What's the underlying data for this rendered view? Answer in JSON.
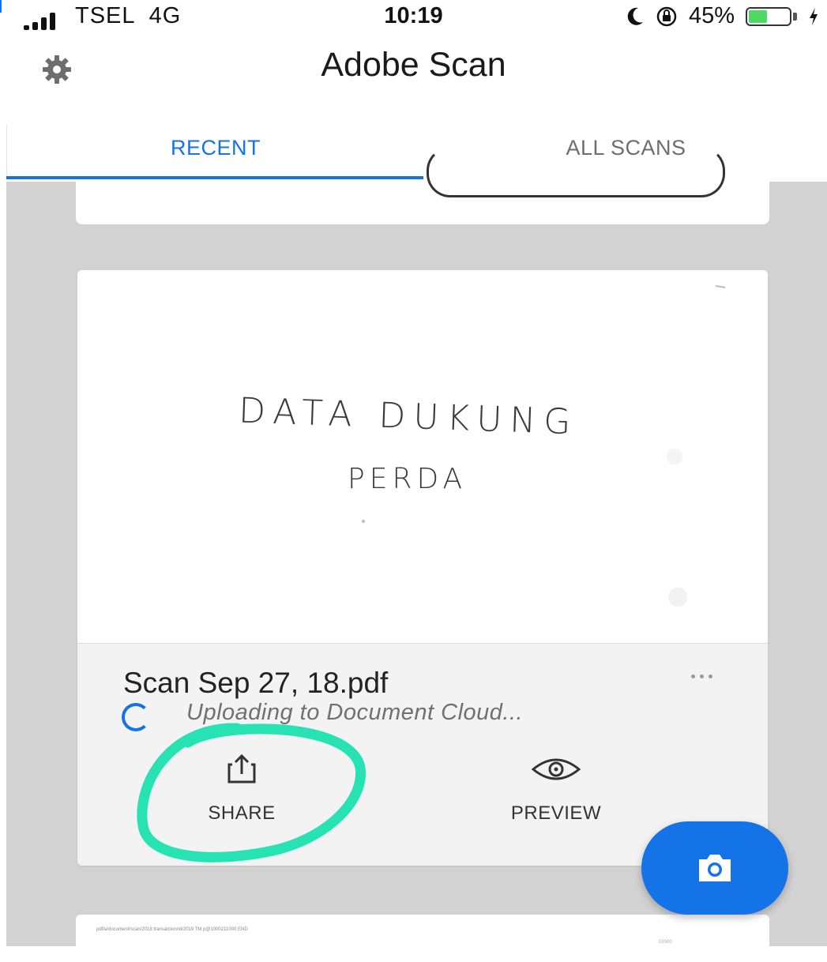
{
  "status_bar": {
    "carrier": "TSEL  4G",
    "time": "10:19",
    "battery_percent": "45%",
    "battery_level": 0.45
  },
  "header": {
    "title": "Adobe Scan",
    "settings_icon": "gear-icon"
  },
  "tabs": [
    {
      "label": "RECENT",
      "active": true
    },
    {
      "label": "ALL SCANS",
      "active": false
    }
  ],
  "scan_card": {
    "handwriting_line1": "DATA DUKUNG",
    "handwriting_line2": "PERDA",
    "filename": "Scan Sep 27, 18.pdf",
    "status": "Uploading to Document Cloud...",
    "actions": [
      {
        "label": "SHARE",
        "icon": "share-icon"
      },
      {
        "label": "PREVIEW",
        "icon": "eye-icon"
      }
    ]
  },
  "next_card": {
    "thumbnail_text": "pdf/a/document/scan/2018   transaction/id/2019   TM p@1000211000 END",
    "thumbnail_code": "02000"
  },
  "colors": {
    "accent": "#1473e6",
    "annotation": "#27e3b4",
    "battery": "#4cd964"
  },
  "fab_icon": "camera-icon"
}
